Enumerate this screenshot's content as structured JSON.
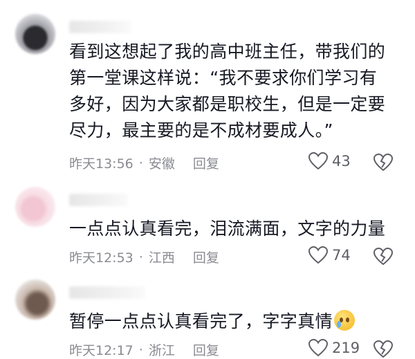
{
  "comments": [
    {
      "text": "看到这想起了我的高中班主任，带我们的第一堂课这样说：“我不要求你们学习有多好，因为大家都是职校生，但是一定要尽力，最主要的是不成材要成人。”",
      "time": "昨天13:56",
      "location": "安徽",
      "reply": "回复",
      "likes": "43"
    },
    {
      "text": "一点点认真看完，泪流满面，文字的力量",
      "time": "昨天12:53",
      "location": "江西",
      "reply": "回复",
      "likes": "74"
    },
    {
      "text": "暂停一点点认真看完了，字字真情",
      "time": "昨天12:17",
      "location": "浙江",
      "reply": "回复",
      "likes": "219"
    }
  ],
  "separator": "·",
  "icons": {
    "like": "heart-outline-icon",
    "dislike": "broken-heart-icon",
    "emoji": "crying-face-emoji"
  }
}
